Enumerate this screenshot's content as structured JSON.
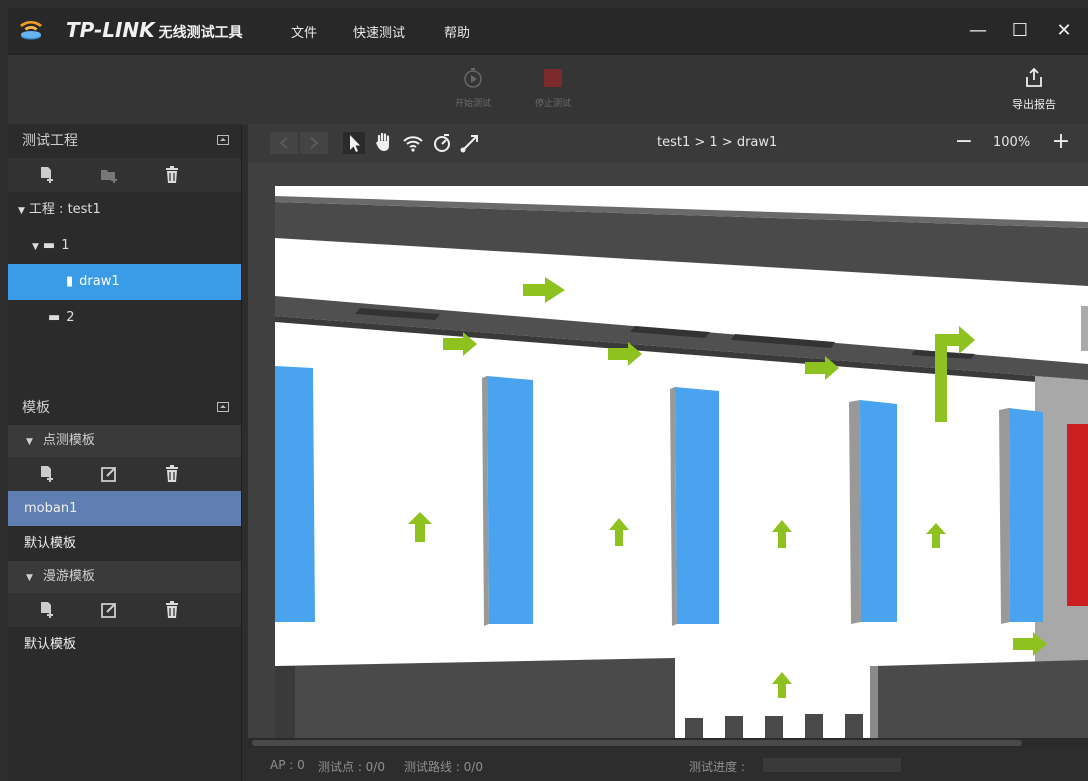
{
  "app": {
    "brand": "TP-LINK",
    "subtitle": "无线测试工具",
    "accent": "#3a9be6"
  },
  "menu": [
    "文件",
    "快速测试",
    "帮助"
  ],
  "window_controls": {
    "minimize": "—",
    "maximize": "☐",
    "close": "✕"
  },
  "toolbar": {
    "start_label": "开始测试",
    "stop_label": "停止测试",
    "export_label": "导出报告"
  },
  "project_panel": {
    "title": "测试工程",
    "tree": {
      "project": "工程 : test1",
      "folder1": "1",
      "file1": "draw1",
      "folder2": "2"
    }
  },
  "template_panel": {
    "title": "模板",
    "point_section": "点测模板",
    "point_items": [
      "moban1",
      "默认模板"
    ],
    "roam_section": "漫游模板",
    "roam_items": [
      "默认模板"
    ]
  },
  "canvas": {
    "breadcrumb": "test1 > 1 > draw1",
    "zoom": "100%",
    "zoom_out": "−",
    "zoom_in": "+"
  },
  "status": {
    "ap": "AP : 0",
    "points": "测试点 : 0/0",
    "routes": "测试路线 : 0/0",
    "progress_label": "测试进度 :",
    "progress_fraction": 0
  },
  "colors": {
    "shelf_blue": "#4aa3ef",
    "arrow_green": "#8dc21f",
    "wall_gray": "#4a4a4a",
    "red_box": "#cc1f1f"
  }
}
